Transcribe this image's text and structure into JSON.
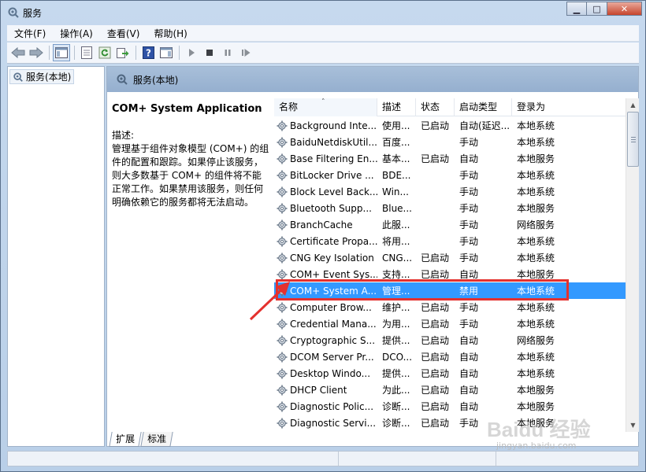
{
  "window": {
    "title": "服务",
    "minimize": "▁",
    "maximize": "□",
    "close": "✕"
  },
  "menu": [
    "文件(F)",
    "操作(A)",
    "查看(V)",
    "帮助(H)"
  ],
  "toolbar": {
    "icons": [
      "back-arrow-icon",
      "forward-arrow-icon",
      "console-tree-icon",
      "properties-icon",
      "refresh-icon",
      "export-list-icon",
      "help-icon",
      "show-action-pane-icon",
      "play-icon",
      "stop-icon",
      "pause-icon",
      "restart-icon"
    ]
  },
  "tree": {
    "root_label": "服务(本地)"
  },
  "right_header": {
    "title": "服务(本地)"
  },
  "description": {
    "service_name": "COM+ System Application",
    "label": "描述:",
    "text": "管理基于组件对象模型 (COM+) 的组件的配置和跟踪。如果停止该服务，则大多数基于 COM+ 的组件将不能正常工作。如果禁用该服务，则任何明确依赖它的服务都将无法启动。"
  },
  "table": {
    "columns": [
      "名称",
      "描述",
      "状态",
      "启动类型",
      "登录为"
    ],
    "sort_arrow": "˄",
    "rows": [
      {
        "name": "Background Inte...",
        "desc": "使用...",
        "status": "已启动",
        "startup": "自动(延迟...",
        "logon": "本地系统"
      },
      {
        "name": "BaiduNetdiskUtil...",
        "desc": "百度...",
        "status": "",
        "startup": "手动",
        "logon": "本地系统"
      },
      {
        "name": "Base Filtering En...",
        "desc": "基本...",
        "status": "已启动",
        "startup": "自动",
        "logon": "本地服务"
      },
      {
        "name": "BitLocker Drive ...",
        "desc": "BDE...",
        "status": "",
        "startup": "手动",
        "logon": "本地系统"
      },
      {
        "name": "Block Level Back...",
        "desc": "Win...",
        "status": "",
        "startup": "手动",
        "logon": "本地系统"
      },
      {
        "name": "Bluetooth Supp...",
        "desc": "Blue...",
        "status": "",
        "startup": "手动",
        "logon": "本地服务"
      },
      {
        "name": "BranchCache",
        "desc": "此服...",
        "status": "",
        "startup": "手动",
        "logon": "网络服务"
      },
      {
        "name": "Certificate Propa...",
        "desc": "将用...",
        "status": "",
        "startup": "手动",
        "logon": "本地系统"
      },
      {
        "name": "CNG Key Isolation",
        "desc": "CNG...",
        "status": "已启动",
        "startup": "手动",
        "logon": "本地系统"
      },
      {
        "name": "COM+ Event Sys...",
        "desc": "支持...",
        "status": "已启动",
        "startup": "自动",
        "logon": "本地服务"
      },
      {
        "name": "COM+ System A...",
        "desc": "管理...",
        "status": "",
        "startup": "禁用",
        "logon": "本地系统",
        "selected": true
      },
      {
        "name": "Computer Brow...",
        "desc": "维护...",
        "status": "已启动",
        "startup": "手动",
        "logon": "本地系统"
      },
      {
        "name": "Credential Mana...",
        "desc": "为用...",
        "status": "已启动",
        "startup": "手动",
        "logon": "本地系统"
      },
      {
        "name": "Cryptographic S...",
        "desc": "提供...",
        "status": "已启动",
        "startup": "自动",
        "logon": "网络服务"
      },
      {
        "name": "DCOM Server Pr...",
        "desc": "DCO...",
        "status": "已启动",
        "startup": "自动",
        "logon": "本地系统"
      },
      {
        "name": "Desktop Windo...",
        "desc": "提供...",
        "status": "已启动",
        "startup": "自动",
        "logon": "本地系统"
      },
      {
        "name": "DHCP Client",
        "desc": "为此...",
        "status": "已启动",
        "startup": "自动",
        "logon": "本地服务"
      },
      {
        "name": "Diagnostic Polic...",
        "desc": "诊断...",
        "status": "已启动",
        "startup": "自动",
        "logon": "本地服务"
      },
      {
        "name": "Diagnostic Servi...",
        "desc": "诊断...",
        "status": "已启动",
        "startup": "手动",
        "logon": "本地服务"
      }
    ]
  },
  "tabs": [
    "扩展",
    "标准"
  ],
  "watermark": {
    "main": "Baidu 经验",
    "sub": "jingyan.baidu.com"
  },
  "colors": {
    "selection": "#3399ff",
    "highlight_box": "#e4312e",
    "header": "#a8bfd9"
  }
}
